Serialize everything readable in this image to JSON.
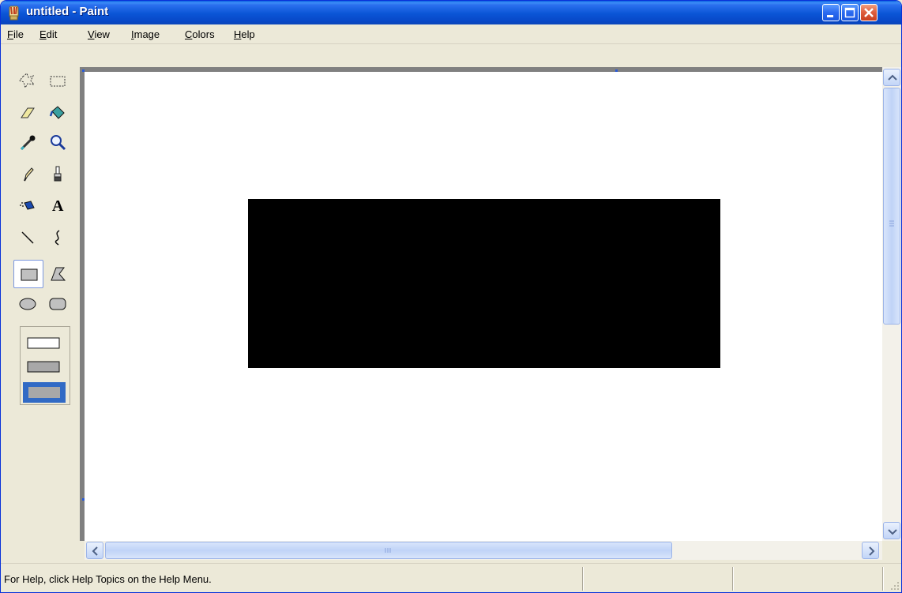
{
  "window": {
    "title": "untitled - Paint",
    "app_icon": "paint-app-icon",
    "controls": [
      "minimize-icon",
      "maximize-icon",
      "close-icon"
    ]
  },
  "menu": {
    "items": [
      {
        "label": "File",
        "accel": "F"
      },
      {
        "label": "Edit",
        "accel": "E"
      },
      {
        "label": "View",
        "accel": "V"
      },
      {
        "label": "Image",
        "accel": "I"
      },
      {
        "label": "Colors",
        "accel": "C"
      },
      {
        "label": "Help",
        "accel": "H"
      }
    ]
  },
  "toolbox": {
    "tools": [
      {
        "name": "free-form-select",
        "icon": "free-form-select-icon"
      },
      {
        "name": "select",
        "icon": "rect-select-icon"
      },
      {
        "name": "eraser",
        "icon": "eraser-icon"
      },
      {
        "name": "fill-with-color",
        "icon": "paint-bucket-icon"
      },
      {
        "name": "pick-color",
        "icon": "eyedropper-icon"
      },
      {
        "name": "magnifier",
        "icon": "magnifier-icon"
      },
      {
        "name": "pencil",
        "icon": "pencil-icon"
      },
      {
        "name": "brush",
        "icon": "brush-icon"
      },
      {
        "name": "airbrush",
        "icon": "airbrush-icon"
      },
      {
        "name": "text",
        "icon": "text-tool-icon",
        "glyph": "A"
      },
      {
        "name": "line",
        "icon": "line-icon"
      },
      {
        "name": "curve",
        "icon": "curve-icon"
      },
      {
        "name": "rectangle",
        "icon": "rectangle-icon",
        "selected": true
      },
      {
        "name": "polygon",
        "icon": "polygon-icon"
      },
      {
        "name": "ellipse",
        "icon": "ellipse-icon"
      },
      {
        "name": "rounded-rectangle",
        "icon": "rounded-rectangle-icon"
      }
    ],
    "fill_options": [
      "outline-only",
      "outline-and-fill",
      "fill-only"
    ],
    "selected_fill_option": "fill-only"
  },
  "canvas": {
    "background": "#ffffff",
    "shapes": [
      {
        "type": "filled-rectangle",
        "color": "#000000"
      }
    ]
  },
  "scrollbars": {
    "vertical_icons": [
      "scroll-up-arrow-icon",
      "scroll-down-arrow-icon"
    ],
    "horizontal_icons": [
      "scroll-left-arrow-icon",
      "scroll-right-arrow-icon"
    ]
  },
  "status": {
    "text": "For Help, click Help Topics on the Help Menu."
  },
  "colors": {
    "titlebar": "#0a55d6",
    "chrome": "#ece9d8",
    "canvas_frame": "#808080",
    "accent": "#2b5bd6"
  }
}
